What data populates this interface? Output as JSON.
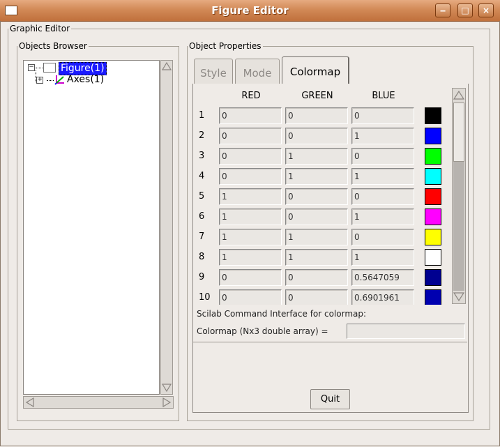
{
  "window": {
    "title": "Figure Editor"
  },
  "graphic_editor": {
    "legend": "Graphic Editor"
  },
  "objects_browser": {
    "legend": "Objects Browser",
    "tree": [
      {
        "label": "Figure(1)",
        "selected": true
      },
      {
        "label": "Axes(1)",
        "selected": false
      }
    ]
  },
  "object_properties": {
    "legend": "Object Properties",
    "tabs": [
      {
        "label": "Style",
        "active": false
      },
      {
        "label": "Mode",
        "active": false
      },
      {
        "label": "Colormap",
        "active": true
      }
    ],
    "colormap": {
      "headers": [
        "RED",
        "GREEN",
        "BLUE"
      ],
      "rows": [
        {
          "index": "1",
          "red": "0",
          "green": "0",
          "blue": "0",
          "color": "#000000"
        },
        {
          "index": "2",
          "red": "0",
          "green": "0",
          "blue": "1",
          "color": "#0000ff"
        },
        {
          "index": "3",
          "red": "0",
          "green": "1",
          "blue": "0",
          "color": "#00ff00"
        },
        {
          "index": "4",
          "red": "0",
          "green": "1",
          "blue": "1",
          "color": "#00ffff"
        },
        {
          "index": "5",
          "red": "1",
          "green": "0",
          "blue": "0",
          "color": "#ff0000"
        },
        {
          "index": "6",
          "red": "1",
          "green": "0",
          "blue": "1",
          "color": "#ff00ff"
        },
        {
          "index": "7",
          "red": "1",
          "green": "1",
          "blue": "0",
          "color": "#ffff00"
        },
        {
          "index": "8",
          "red": "1",
          "green": "1",
          "blue": "1",
          "color": "#ffffff"
        },
        {
          "index": "9",
          "red": "0",
          "green": "0",
          "blue": "0.5647059",
          "color": "#000090"
        },
        {
          "index": "10",
          "red": "0",
          "green": "0",
          "blue": "0.6901961",
          "color": "#0000b0"
        }
      ]
    },
    "scilab_label": "Scilab Command Interface for colormap:",
    "colormap_expr_label": "Colormap (Nx3 double array) =",
    "colormap_expr_value": "",
    "quit_label": "Quit"
  }
}
